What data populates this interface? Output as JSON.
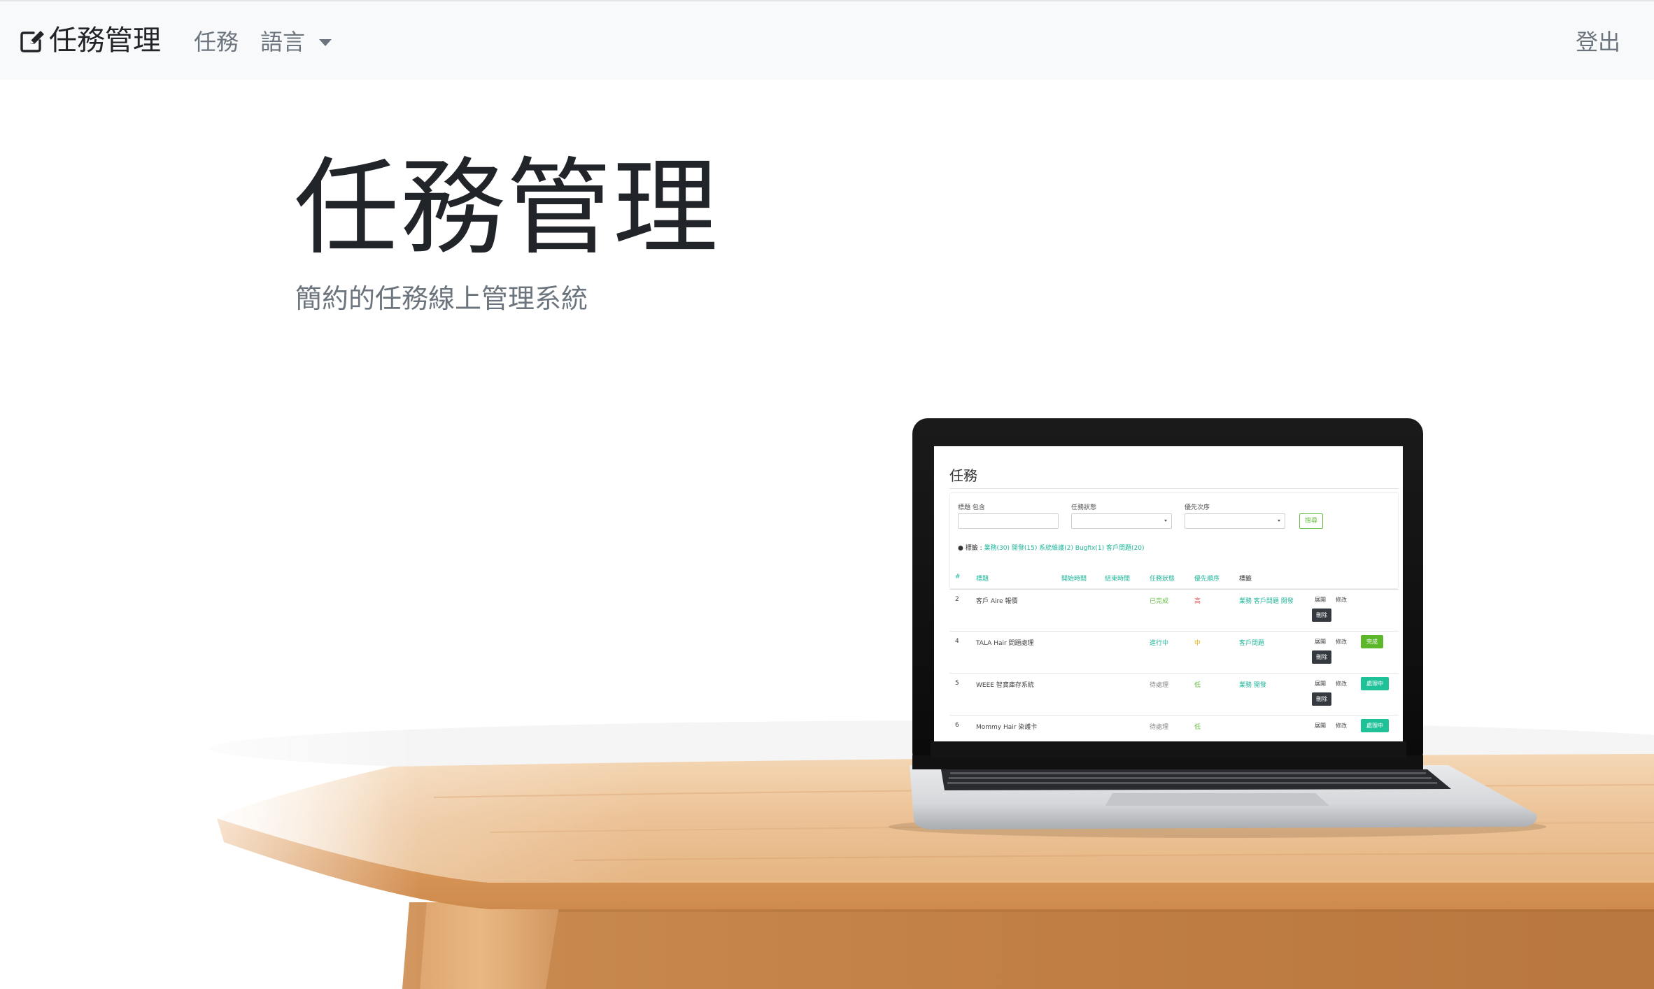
{
  "navbar": {
    "brand": "任務管理",
    "tasks_link": "任務",
    "language_menu": "語言",
    "logout_link": "登出"
  },
  "hero": {
    "title": "任務管理",
    "lead": "簡約的任務線上管理系統"
  },
  "colors": {
    "navbar_bg": "#f8f9fa",
    "accent_teal": "#1fc199",
    "accent_green": "#5cb82a",
    "dark_button": "#343a40",
    "wood": "#e9b98a"
  },
  "screenshot": {
    "heading": "任務",
    "filters": {
      "title_label": "標題 包含",
      "status_label": "任務狀態",
      "priority_label": "優先次序",
      "search_button": "搜尋"
    },
    "tags_label": "標籤 :",
    "tags": "業務(30) 開發(15) 系統維護(2) Bugfix(1) 客戶問題(20)",
    "columns": [
      "#",
      "標題",
      "開始時間",
      "結束時間",
      "任務狀態",
      "優先順序",
      "標籤"
    ],
    "rows": [
      {
        "id": "2",
        "title": "客戶 Aire 報價",
        "status": "已完成",
        "priority": "高",
        "tags": "業務 客戶問題 開發",
        "actions": [
          "展開",
          "修改",
          "刪除"
        ]
      },
      {
        "id": "4",
        "title": "TALA Hair 問題處理",
        "status": "進行中",
        "priority": "中",
        "tags": "客戶問題",
        "actions": [
          "展開",
          "修改",
          "完成",
          "刪除"
        ]
      },
      {
        "id": "5",
        "title": "WEEE 智寶庫存系統",
        "status": "待處理",
        "priority": "低",
        "tags": "業務 開發",
        "actions": [
          "展開",
          "修改",
          "處理中",
          "刪除"
        ]
      },
      {
        "id": "6",
        "title": "Mommy Hair 染護卡",
        "status": "待處理",
        "priority": "低",
        "tags": "",
        "actions": [
          "展開",
          "修改",
          "處理中"
        ]
      }
    ]
  }
}
